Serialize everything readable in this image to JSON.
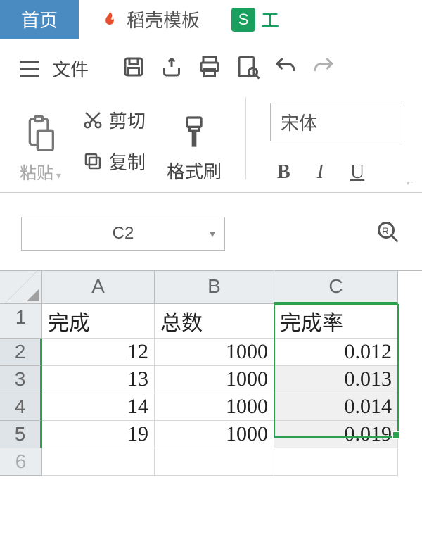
{
  "tabs": {
    "home": "首页",
    "template": "稻壳模板",
    "app": "工"
  },
  "menubar": {
    "file": "文件"
  },
  "clipboard": {
    "paste": "粘贴",
    "cut": "剪切",
    "copy": "复制",
    "format_painter": "格式刷"
  },
  "font": {
    "name": "宋体",
    "bold": "B",
    "italic": "I",
    "underline": "U"
  },
  "namebox": {
    "value": "C2"
  },
  "columns": [
    "A",
    "B",
    "C"
  ],
  "row_headers": [
    "1",
    "2",
    "3",
    "4",
    "5",
    "6"
  ],
  "sheet": {
    "headers": [
      "完成",
      "总数",
      "完成率"
    ],
    "rows": [
      {
        "a": "12",
        "b": "1000",
        "c": "0.012"
      },
      {
        "a": "13",
        "b": "1000",
        "c": "0.013"
      },
      {
        "a": "14",
        "b": "1000",
        "c": "0.014"
      },
      {
        "a": "19",
        "b": "1000",
        "c": "0.019"
      }
    ]
  },
  "chart_data": {
    "type": "table",
    "columns": [
      "完成",
      "总数",
      "完成率"
    ],
    "data": [
      [
        12,
        1000,
        0.012
      ],
      [
        13,
        1000,
        0.013
      ],
      [
        14,
        1000,
        0.014
      ],
      [
        19,
        1000,
        0.019
      ]
    ]
  }
}
